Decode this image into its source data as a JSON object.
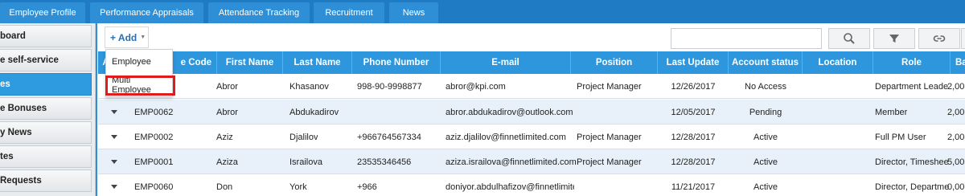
{
  "top_tabs": [
    "Employee Profile",
    "Performance Appraisals",
    "Attendance Tracking",
    "Recruitment",
    "News"
  ],
  "sidebar": {
    "items": [
      {
        "label": "board",
        "active": false
      },
      {
        "label": "e self-service",
        "active": false
      },
      {
        "label": "es",
        "active": true
      },
      {
        "label": "e Bonuses",
        "active": false
      },
      {
        "label": "y News",
        "active": false
      },
      {
        "label": "tes",
        "active": false
      },
      {
        "label": "Requests",
        "active": false
      }
    ]
  },
  "toolbar": {
    "add_label": "+ Add",
    "search_value": "",
    "buttons": [
      "search-icon",
      "filter-icon",
      "link-icon"
    ]
  },
  "dropdown": {
    "items": [
      "Employee",
      "Multi Employee"
    ],
    "highlighted": "Multi Employee"
  },
  "table": {
    "columns": [
      "A",
      "e Code",
      "First Name",
      "Last Name",
      "Phone Number",
      "E-mail",
      "Position",
      "Last Update",
      "Account status",
      "Location",
      "Role",
      "Ba"
    ],
    "rows": [
      {
        "code": "",
        "first": "Abror",
        "last": "Khasanov",
        "phone": "998-90-9998877",
        "email": "abror@kpi.com",
        "position": "Project Manager",
        "update": "12/26/2017",
        "status": "No Access",
        "location": "",
        "role": "Department Leade",
        "ba": "2,00"
      },
      {
        "code": "EMP0062",
        "first": "Abror",
        "last": "Abdukadirov",
        "phone": "",
        "email": "abror.abdukadirov@outlook.com",
        "position": "",
        "update": "12/05/2017",
        "status": "Pending",
        "location": "",
        "role": "Member",
        "ba": "2,00"
      },
      {
        "code": "EMP0002",
        "first": "Aziz",
        "last": "Djalilov",
        "phone": "+966764567334",
        "email": "aziz.djalilov@finnetlimited.com",
        "position": "Project Manager",
        "update": "12/28/2017",
        "status": "Active",
        "location": "",
        "role": "Full PM User",
        "ba": "2,00"
      },
      {
        "code": "EMP0001",
        "first": "Aziza",
        "last": "Israilova",
        "phone": "23535346456",
        "email": "aziza.israilova@finnetlimited.com",
        "position": "Project Manager",
        "update": "12/28/2017",
        "status": "Active",
        "location": "",
        "role": "Director, Timeshee",
        "ba": "5,00"
      },
      {
        "code": "EMP0060",
        "first": "Don",
        "last": "York",
        "phone": "+966",
        "email": "doniyor.abdulhafizov@finnetlimite",
        "position": "",
        "update": "11/21/2017",
        "status": "Active",
        "location": "",
        "role": "Director, Departme",
        "ba": "0,00"
      }
    ]
  },
  "colors": {
    "header_blue": "#2e96dc",
    "topbar_blue": "#1f7cc4",
    "highlight_red": "#e01b1b",
    "row_alt": "#e8f1fa"
  }
}
